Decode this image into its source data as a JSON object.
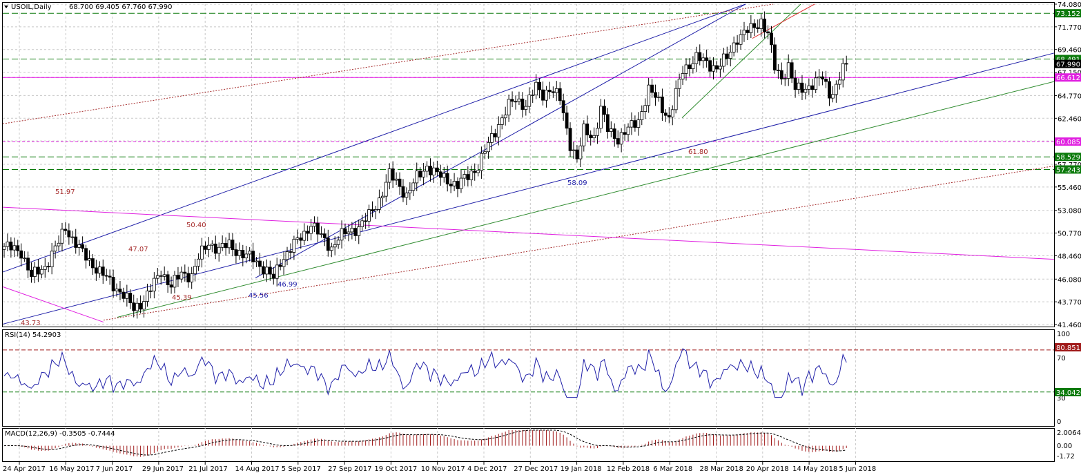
{
  "header": {
    "symbol": "USOIL,Daily",
    "ohlc": "68.700 69.405 67.760 67.990"
  },
  "panels": {
    "rsi": {
      "title": "RSI(14) 54.2903",
      "levels_text": [
        "100",
        "70",
        "30",
        "0"
      ],
      "badges": [
        "80.8511",
        "34.0426"
      ]
    },
    "macd": {
      "title": "MACD(12,26,9) -0.3505 -0.7444",
      "ticks": [
        "2.0064",
        "0.00",
        "-1.72"
      ]
    }
  },
  "colors": {
    "candle": "#000000",
    "grid": "#c8c8c8",
    "channel": "#1f1fa8",
    "fib_text_red": "#a52a2a",
    "fib_text_blue": "#1f1fa8",
    "magenta": "#e020e0",
    "green": "#2e8b2e",
    "dark_green": "#006400",
    "badge_green": "#0b7a0b",
    "rsi_line": "#1f1fa8",
    "macd_bar": "#a01a1a"
  },
  "chart_data": [
    {
      "type": "candlestick",
      "title": "USOIL,Daily",
      "ylim": [
        41.46,
        74.08
      ],
      "y_ticks": [
        "74.080",
        "71.770",
        "69.460",
        "67.150",
        "64.770",
        "62.460",
        "60.150",
        "57.770",
        "55.460",
        "53.080",
        "50.770",
        "48.460",
        "46.080",
        "43.770",
        "41.460"
      ],
      "x_ticks": [
        "24 Apr 2017",
        "16 May 2017",
        "7 Jun 2017",
        "29 Jun 2017",
        "21 Jul 2017",
        "14 Aug 2017",
        "5 Sep 2017",
        "27 Sep 2017",
        "19 Oct 2017",
        "10 Nov 2017",
        "4 Dec 2017",
        "27 Dec 2017",
        "19 Jan 2018",
        "12 Feb 2018",
        "6 Mar 2018",
        "28 Mar 2018",
        "20 Apr 2018",
        "14 May 2018",
        "5 Jun 2018"
      ],
      "price_badges": [
        {
          "label": "73.152",
          "value": 73.152,
          "color": "#0b7a0b"
        },
        {
          "label": "68.491",
          "value": 68.491,
          "color": "#0b7a0b"
        },
        {
          "label": "67.990",
          "value": 67.99,
          "color": "#000000"
        },
        {
          "label": "66.612",
          "value": 66.612,
          "color": "#e020e0"
        },
        {
          "label": "60.085",
          "value": 60.085,
          "color": "#e020e0"
        },
        {
          "label": "58.529",
          "value": 58.529,
          "color": "#0b7a0b"
        },
        {
          "label": "57.243",
          "value": 57.243,
          "color": "#0b7a0b"
        }
      ],
      "annotations": [
        {
          "text": "51.97",
          "color": "#a52a2a"
        },
        {
          "text": "50.40",
          "color": "#a52a2a"
        },
        {
          "text": "47.07",
          "color": "#a52a2a"
        },
        {
          "text": "45.39",
          "color": "#a52a2a"
        },
        {
          "text": "43.73",
          "color": "#a52a2a"
        },
        {
          "text": "46.99",
          "color": "#1f1fa8"
        },
        {
          "text": "45.56",
          "color": "#1f1fa8"
        },
        {
          "text": "58.09",
          "color": "#1f1fa8"
        },
        {
          "text": "61.80",
          "color": "#a52a2a"
        }
      ],
      "anchors": [
        {
          "i": 0,
          "c": 49.4
        },
        {
          "i": 5,
          "c": 48.9
        },
        {
          "i": 8,
          "c": 46.3
        },
        {
          "i": 12,
          "c": 47.4
        },
        {
          "i": 16,
          "c": 49.8
        },
        {
          "i": 18,
          "c": 51.4
        },
        {
          "i": 20,
          "c": 50.2
        },
        {
          "i": 23,
          "c": 48.7
        },
        {
          "i": 27,
          "c": 47.2
        },
        {
          "i": 31,
          "c": 45.8
        },
        {
          "i": 35,
          "c": 44.5
        },
        {
          "i": 38,
          "c": 43.0
        },
        {
          "i": 41,
          "c": 44.0
        },
        {
          "i": 44,
          "c": 45.6
        },
        {
          "i": 46,
          "c": 46.9
        },
        {
          "i": 49,
          "c": 45.4
        },
        {
          "i": 52,
          "c": 46.6
        },
        {
          "i": 55,
          "c": 46.5
        },
        {
          "i": 57,
          "c": 48.2
        },
        {
          "i": 60,
          "c": 49.8
        },
        {
          "i": 63,
          "c": 49.1
        },
        {
          "i": 66,
          "c": 49.6
        },
        {
          "i": 70,
          "c": 48.5
        },
        {
          "i": 73,
          "c": 48.2
        },
        {
          "i": 76,
          "c": 47.2
        },
        {
          "i": 79,
          "c": 46.1
        },
        {
          "i": 81,
          "c": 47.9
        },
        {
          "i": 84,
          "c": 49.2
        },
        {
          "i": 88,
          "c": 50.7
        },
        {
          "i": 90,
          "c": 51.8
        },
        {
          "i": 93,
          "c": 50.3
        },
        {
          "i": 96,
          "c": 49.3
        },
        {
          "i": 98,
          "c": 50.3
        },
        {
          "i": 101,
          "c": 50.9
        },
        {
          "i": 104,
          "c": 51.4
        },
        {
          "i": 107,
          "c": 52.5
        },
        {
          "i": 110,
          "c": 54.2
        },
        {
          "i": 113,
          "c": 56.7
        },
        {
          "i": 116,
          "c": 55.6
        },
        {
          "i": 118,
          "c": 54.6
        },
        {
          "i": 121,
          "c": 56.4
        },
        {
          "i": 124,
          "c": 57.6
        },
        {
          "i": 127,
          "c": 56.7
        },
        {
          "i": 130,
          "c": 56.2
        },
        {
          "i": 133,
          "c": 55.6
        },
        {
          "i": 136,
          "c": 56.6
        },
        {
          "i": 139,
          "c": 57.6
        },
        {
          "i": 142,
          "c": 59.8
        },
        {
          "i": 145,
          "c": 61.9
        },
        {
          "i": 148,
          "c": 63.7
        },
        {
          "i": 150,
          "c": 64.4
        },
        {
          "i": 153,
          "c": 63.8
        },
        {
          "i": 156,
          "c": 65.6
        },
        {
          "i": 158,
          "c": 64.9
        },
        {
          "i": 160,
          "c": 65.5
        },
        {
          "i": 163,
          "c": 64.4
        },
        {
          "i": 166,
          "c": 59.9
        },
        {
          "i": 168,
          "c": 58.2
        },
        {
          "i": 170,
          "c": 61.2
        },
        {
          "i": 173,
          "c": 60.6
        },
        {
          "i": 175,
          "c": 63.4
        },
        {
          "i": 177,
          "c": 61.3
        },
        {
          "i": 180,
          "c": 60.4
        },
        {
          "i": 183,
          "c": 61.3
        },
        {
          "i": 186,
          "c": 62.3
        },
        {
          "i": 189,
          "c": 65.3
        },
        {
          "i": 192,
          "c": 64.2
        },
        {
          "i": 195,
          "c": 62.4
        },
        {
          "i": 197,
          "c": 64.9
        },
        {
          "i": 199,
          "c": 67.4
        },
        {
          "i": 203,
          "c": 68.6
        },
        {
          "i": 206,
          "c": 68.1
        },
        {
          "i": 209,
          "c": 67.6
        },
        {
          "i": 212,
          "c": 68.6
        },
        {
          "i": 215,
          "c": 70.7
        },
        {
          "i": 219,
          "c": 71.5
        },
        {
          "i": 222,
          "c": 72.4
        },
        {
          "i": 224,
          "c": 71.0
        },
        {
          "i": 226,
          "c": 67.6
        },
        {
          "i": 228,
          "c": 66.6
        },
        {
          "i": 230,
          "c": 67.8
        },
        {
          "i": 232,
          "c": 65.3
        },
        {
          "i": 235,
          "c": 65.6
        },
        {
          "i": 238,
          "c": 66.1
        },
        {
          "i": 240,
          "c": 66.6
        },
        {
          "i": 242,
          "c": 65.0
        },
        {
          "i": 244,
          "c": 65.6
        },
        {
          "i": 246,
          "c": 67.6
        },
        {
          "i": 247,
          "c": 67.99
        }
      ],
      "rsi_range": [
        0,
        100
      ],
      "rsi_levels": [
        80.8511,
        34.0426
      ],
      "macd_range": [
        -1.72,
        2.0064
      ]
    }
  ]
}
